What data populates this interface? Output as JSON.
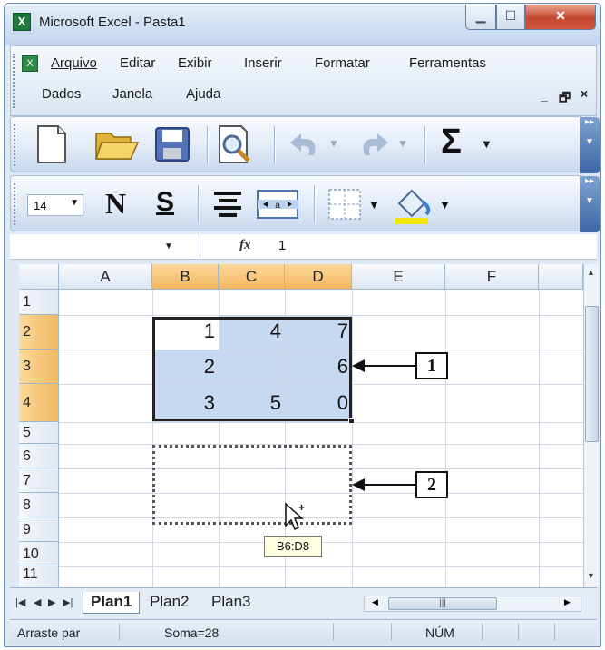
{
  "window": {
    "title": "Microsoft Excel - Pasta1",
    "app_icon_glyph": "X"
  },
  "menu": {
    "items": [
      "Arquivo",
      "Editar",
      "Exibir",
      "Inserir",
      "Formatar",
      "Ferramentas",
      "Dados",
      "Janela",
      "Ajuda"
    ],
    "doc_controls": [
      "_",
      "🗗",
      "×"
    ]
  },
  "format_toolbar": {
    "font_size": "14",
    "bold": "N",
    "underline": "S"
  },
  "formula_bar": {
    "fx_label": "fx",
    "value": "1"
  },
  "sheet": {
    "columns": [
      "A",
      "B",
      "C",
      "D",
      "E",
      "F"
    ],
    "rows": [
      "1",
      "2",
      "3",
      "4",
      "5",
      "6",
      "7",
      "8",
      "9",
      "10",
      "11"
    ],
    "cells": {
      "B2": "1",
      "C2": "4",
      "D2": "7",
      "B3": "2",
      "D3": "6",
      "B4": "3",
      "C4": "5",
      "D4": "0"
    },
    "selected_range": "B2:D4",
    "drag_tooltip": "B6:D8"
  },
  "tabs": {
    "items": [
      "Plan1",
      "Plan2",
      "Plan3"
    ],
    "active": "Plan1"
  },
  "status": {
    "left_text": "Arraste par",
    "sum_text": "Soma=28",
    "num_text": "NÚM"
  },
  "annotations": {
    "label_1": "1",
    "label_2": "2"
  },
  "colors": {
    "selection": "#c5daf1",
    "header_selected": "#f2b760",
    "title_bg": "#cfdff2"
  }
}
